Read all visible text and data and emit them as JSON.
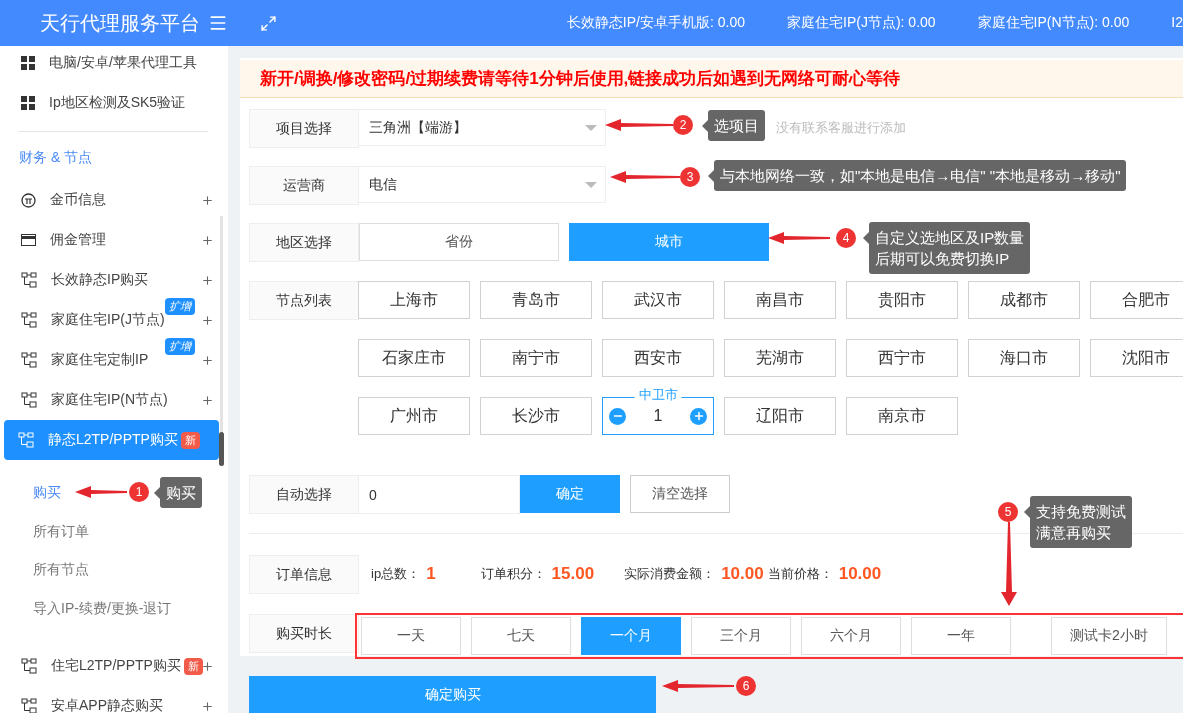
{
  "header": {
    "title": "天行代理服务平台",
    "stats": [
      "长效静态IP/安卓手机版: 0.00",
      "家庭住宅IP(J节点): 0.00",
      "家庭住宅IP(N节点): 0.00",
      "I2"
    ]
  },
  "sidebar": {
    "items": [
      {
        "kind": "grid",
        "label": "电脑/安卓/苹果代理工具",
        "expandable": false,
        "selected": false
      },
      {
        "kind": "grid",
        "label": "Ip地区检测及SK5验证",
        "expandable": false,
        "selected": false
      },
      {
        "kind": "section",
        "label": "财务 & 节点"
      },
      {
        "kind": "coin",
        "label": "金币信息",
        "expandable": true,
        "selected": false
      },
      {
        "kind": "card",
        "label": "佣金管理",
        "expandable": true,
        "selected": false
      },
      {
        "kind": "node",
        "label": "长效静态IP购买",
        "expandable": true,
        "selected": false
      },
      {
        "kind": "node",
        "label": "家庭住宅IP(J节点)",
        "expandable": true,
        "selected": false,
        "badge": {
          "text": "扩增",
          "kind": "info"
        }
      },
      {
        "kind": "node",
        "label": "家庭住宅定制IP",
        "expandable": true,
        "selected": false,
        "badge": {
          "text": "扩增",
          "kind": "info"
        }
      },
      {
        "kind": "node",
        "label": "家庭住宅IP(N节点)",
        "expandable": true,
        "selected": false
      },
      {
        "kind": "node",
        "label": "静态L2TP/PPTP购买",
        "expandable": false,
        "selected": true,
        "badge": {
          "text": "新",
          "kind": "alert"
        },
        "children": [
          {
            "label": "购买",
            "selected": true
          },
          {
            "label": "所有订单",
            "selected": false
          },
          {
            "label": "所有节点",
            "selected": false
          },
          {
            "label": "导入IP-续费/更换-退订",
            "selected": false
          }
        ]
      },
      {
        "kind": "node",
        "label": "住宅L2TP/PPTP购买",
        "expandable": true,
        "selected": false,
        "badge": {
          "text": "新",
          "kind": "alert"
        }
      },
      {
        "kind": "node",
        "label": "安卓APP静态购买",
        "expandable": true,
        "selected": false
      }
    ]
  },
  "notice": "新开/调换/修改密码/过期续费请等待1分钟后使用,链接成功后如遇到无网络可耐心等待",
  "form": {
    "project": {
      "label": "项目选择",
      "value": "三角洲【端游】",
      "hint": "没有联系客服进行添加"
    },
    "carrier": {
      "label": "运营商",
      "value": "电信"
    },
    "region": {
      "label": "地区选择",
      "options": [
        {
          "label": "省份",
          "selected": false
        },
        {
          "label": "城市",
          "selected": true
        }
      ]
    },
    "nodes": {
      "label": "节点列表",
      "cities": [
        {
          "name": "上海市",
          "selected": false
        },
        {
          "name": "青岛市",
          "selected": false
        },
        {
          "name": "武汉市",
          "selected": false
        },
        {
          "name": "南昌市",
          "selected": false
        },
        {
          "name": "贵阳市",
          "selected": false
        },
        {
          "name": "成都市",
          "selected": false
        },
        {
          "name": "合肥市",
          "selected": false
        },
        {
          "name": "石家庄市",
          "selected": false
        },
        {
          "name": "南宁市",
          "selected": false
        },
        {
          "name": "西安市",
          "selected": false
        },
        {
          "name": "芜湖市",
          "selected": false
        },
        {
          "name": "西宁市",
          "selected": false
        },
        {
          "name": "海口市",
          "selected": false
        },
        {
          "name": "沈阳市",
          "selected": false
        },
        {
          "name": "广州市",
          "selected": false
        },
        {
          "name": "长沙市",
          "selected": false
        },
        {
          "name": "中卫市",
          "selected": true,
          "quantity": "1"
        },
        {
          "name": "辽阳市",
          "selected": false
        },
        {
          "name": "南京市",
          "selected": false
        }
      ]
    },
    "auto": {
      "label": "自动选择",
      "value": "0",
      "confirm": "确定",
      "clear": "清空选择"
    },
    "order": {
      "label": "订单信息",
      "stats": [
        {
          "label": "ip总数：",
          "value": "1"
        },
        {
          "label": "订单积分：",
          "value": "15.00"
        },
        {
          "label": "实际消费金额：",
          "value": "10.00"
        },
        {
          "label": "当前价格：",
          "value": "10.00"
        }
      ]
    },
    "duration": {
      "label": "购买时长",
      "options": [
        {
          "label": "一天",
          "selected": false
        },
        {
          "label": "七天",
          "selected": false
        },
        {
          "label": "一个月",
          "selected": true
        },
        {
          "label": "三个月",
          "selected": false
        },
        {
          "label": "六个月",
          "selected": false
        },
        {
          "label": "一年",
          "selected": false
        },
        {
          "label": "测试卡2小时",
          "selected": false
        }
      ]
    },
    "submit": "确定购买"
  },
  "callouts": [
    {
      "number": "1",
      "lines": [
        "购买"
      ]
    },
    {
      "number": "2",
      "lines": [
        "选项目"
      ]
    },
    {
      "number": "3",
      "lines": [
        "与本地网络一致，如\"本地是电信→电信\" \"本地是移动→移动\""
      ]
    },
    {
      "number": "4",
      "lines": [
        "自定义选地区及IP数量",
        "后期可以免费切换IP"
      ]
    },
    {
      "number": "5",
      "lines": [
        "支持免费测试",
        "满意再购买"
      ]
    },
    {
      "number": "6"
    }
  ]
}
